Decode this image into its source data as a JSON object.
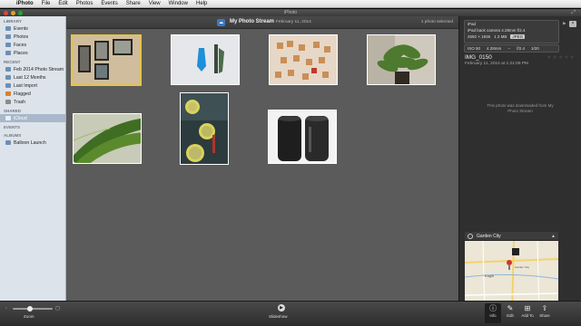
{
  "menubar": {
    "app": "iPhoto",
    "items": [
      "File",
      "Edit",
      "Photos",
      "Events",
      "Share",
      "View",
      "Window",
      "Help"
    ]
  },
  "window": {
    "title": "iPhoto"
  },
  "sidebar": {
    "library_head": "LIBRARY",
    "library": [
      "Events",
      "Photos",
      "Faces",
      "Places"
    ],
    "recent_head": "RECENT",
    "recent": [
      "Feb 2014 Photo Stream",
      "Last 12 Months",
      "Last Import",
      "Flagged",
      "Trash"
    ],
    "shared_head": "SHARED",
    "shared": [
      "iCloud"
    ],
    "events_head": "EVENTS",
    "albums_head": "ALBUMS",
    "albums": [
      "Balloon Launch"
    ]
  },
  "album": {
    "title": "My Photo Stream",
    "date": "February 11, 2014",
    "selected_count": "1 photo selected"
  },
  "info": {
    "device": "iPad",
    "camera": "iPad back camera 4.28mm f/2.4",
    "dimensions": "2592 × 1936",
    "size": "1.3 MB",
    "format": "JPEG",
    "iso": "ISO 50",
    "focal": "4.28mm",
    "ev": "--",
    "aperture": "f/2.4",
    "shutter": "1/20",
    "image_name": "IMG_0150",
    "image_date": "February 11, 2014 at 1:21:06 PM",
    "stars": "★★★★★",
    "note": "This photo was downloaded from My Photo Stream",
    "place": "Garden City",
    "map_label_eagle": "Eagle",
    "map_label_city": "Garden City"
  },
  "toolbar": {
    "zoom": "Zoom",
    "slideshow": "Slideshow",
    "info": "Info",
    "edit": "Edit",
    "add_to": "Add To",
    "share": "Share"
  },
  "colors": {
    "selection": "#e5c34a",
    "sidebar_bg": "#dde3ea",
    "content_bg": "#5b5b5b"
  }
}
